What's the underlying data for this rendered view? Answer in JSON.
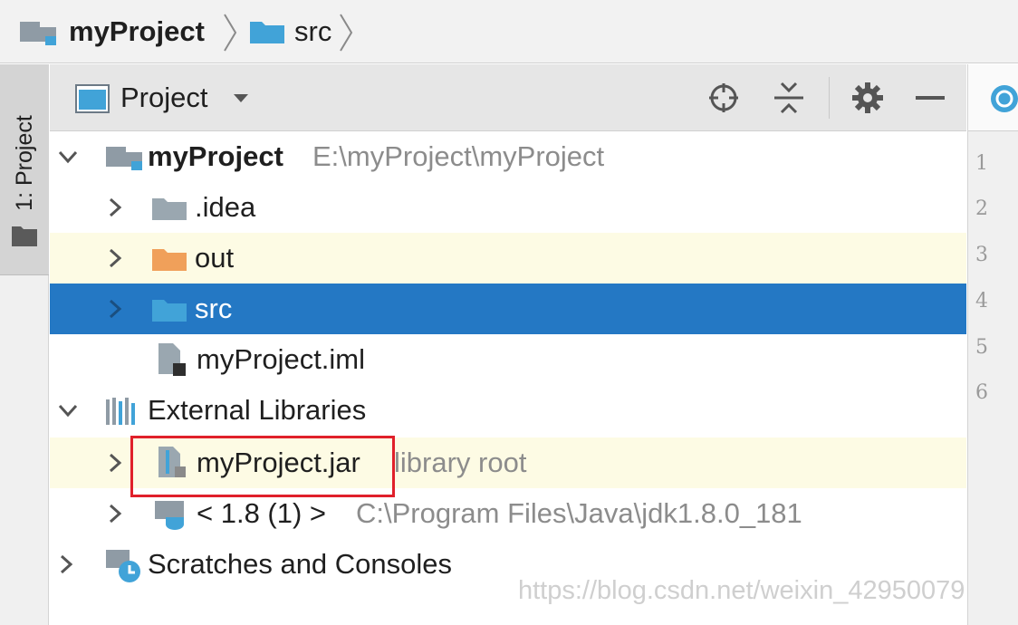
{
  "breadcrumb": {
    "project": "myProject",
    "folder": "src"
  },
  "toolstrip": {
    "tab_label": "1: Project"
  },
  "panel": {
    "view_title": "Project"
  },
  "tree": {
    "root": {
      "label": "myProject",
      "path": "E:\\myProject\\myProject"
    },
    "idea": {
      "label": ".idea"
    },
    "out": {
      "label": "out"
    },
    "src": {
      "label": "src"
    },
    "iml": {
      "label": "myProject.iml"
    },
    "external": {
      "label": "External Libraries"
    },
    "jar": {
      "label": "myProject.jar",
      "path": "library root"
    },
    "jdk": {
      "label": "< 1.8 (1) >",
      "path": "C:\\Program Files\\Java\\jdk1.8.0_181"
    },
    "scratches": {
      "label": "Scratches and Consoles"
    }
  },
  "editor": {
    "line_numbers": [
      "1",
      "2",
      "3",
      "4",
      "5",
      "6"
    ]
  },
  "watermark": "https://blog.csdn.net/weixin_42950079",
  "colors": {
    "selection": "#2478c4",
    "highlight": "#fdfbe4",
    "annotation": "#e0202a",
    "folder_blue": "#41a3d8",
    "folder_orange": "#f0a05a",
    "folder_gray": "#9aa7b0"
  }
}
